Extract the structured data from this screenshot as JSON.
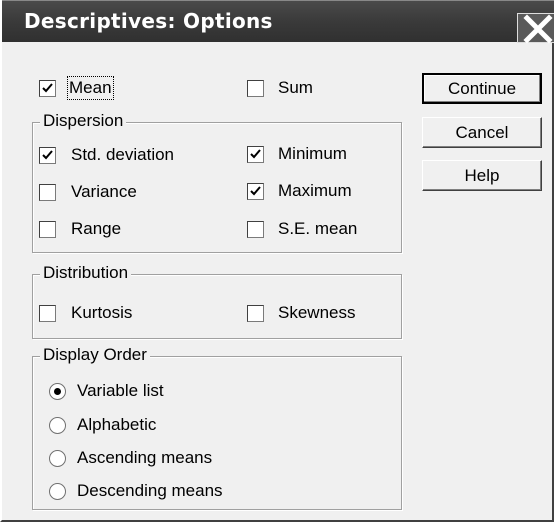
{
  "window": {
    "title": "Descriptives: Options",
    "close_icon": "close-icon"
  },
  "buttons": {
    "continue": "Continue",
    "cancel": "Cancel",
    "help": "Help"
  },
  "top_options": [
    {
      "id": "mean",
      "label": "Mean",
      "checked": true
    },
    {
      "id": "sum",
      "label": "Sum",
      "checked": false
    }
  ],
  "dispersion": {
    "title": "Dispersion",
    "items": [
      {
        "id": "std_deviation",
        "label": "Std. deviation",
        "checked": true
      },
      {
        "id": "minimum",
        "label": "Minimum",
        "checked": true
      },
      {
        "id": "variance",
        "label": "Variance",
        "checked": false
      },
      {
        "id": "maximum",
        "label": "Maximum",
        "checked": true
      },
      {
        "id": "range",
        "label": "Range",
        "checked": false
      },
      {
        "id": "se_mean",
        "label": "S.E. mean",
        "checked": false
      }
    ]
  },
  "distribution": {
    "title": "Distribution",
    "items": [
      {
        "id": "kurtosis",
        "label": "Kurtosis",
        "checked": false
      },
      {
        "id": "skewness",
        "label": "Skewness",
        "checked": false
      }
    ]
  },
  "display_order": {
    "title": "Display Order",
    "selected": "Variable list",
    "options": [
      "Variable list",
      "Alphabetic",
      "Ascending means",
      "Descending means"
    ]
  }
}
